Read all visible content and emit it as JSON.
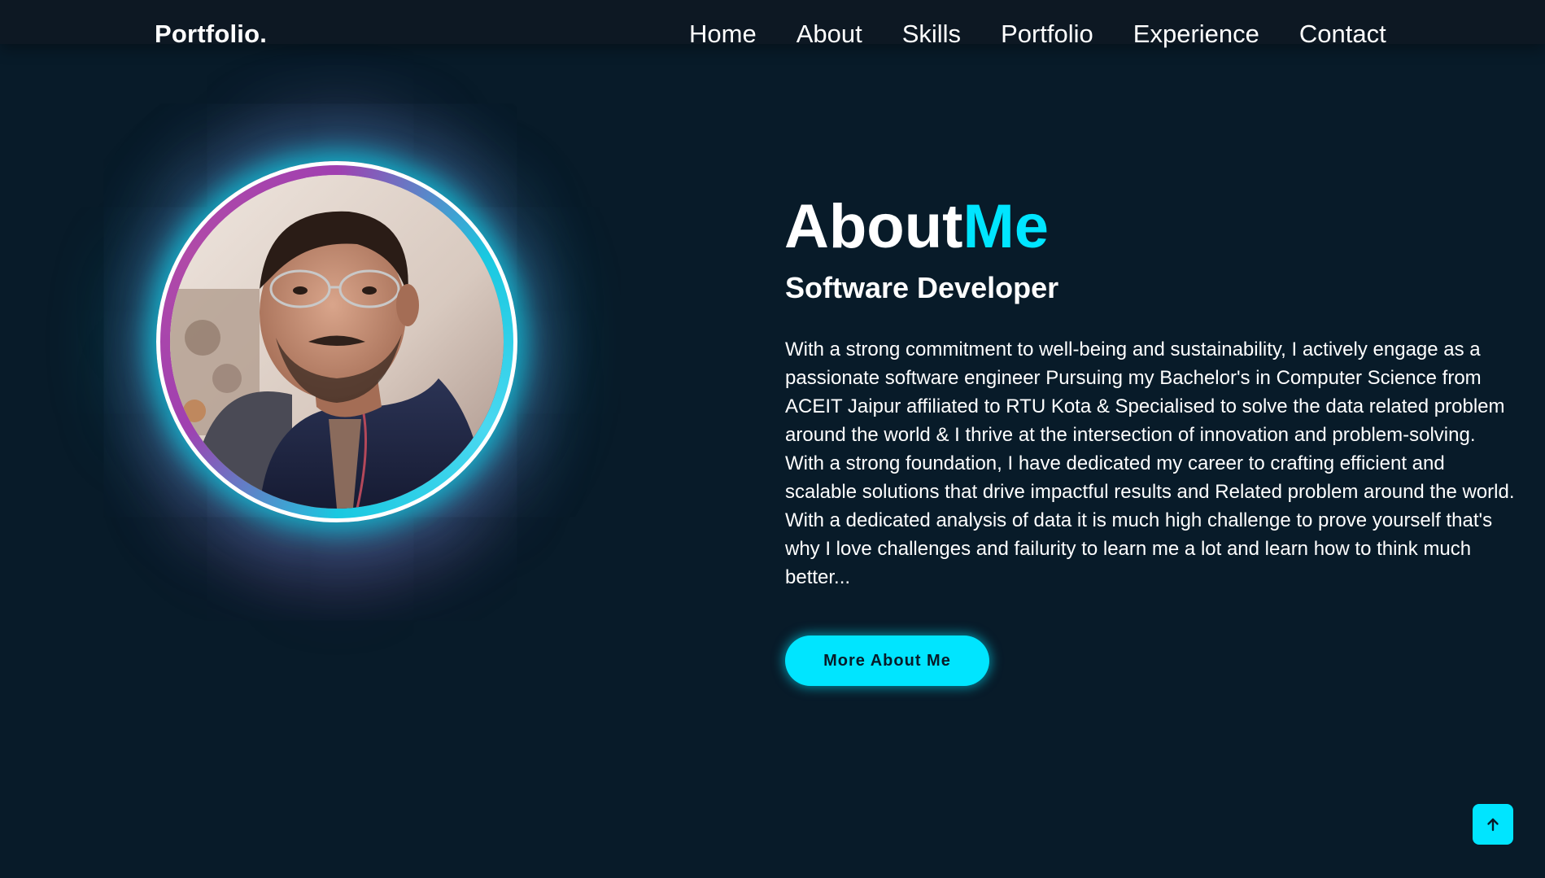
{
  "navbar": {
    "logo": "Portfolio.",
    "links": [
      {
        "label": "Home"
      },
      {
        "label": "About"
      },
      {
        "label": "Skills"
      },
      {
        "label": "Portfolio"
      },
      {
        "label": "Experience"
      },
      {
        "label": "Contact"
      }
    ]
  },
  "about": {
    "title_main": "About",
    "title_accent": "Me",
    "subtitle": "Software Developer",
    "paragraph_lines": [
      "With a strong commitment to well-being and sustainability, I actively engage as a",
      "passionate software engineer Pursuing my Bachelor's in Computer Science from",
      "ACEIT Jaipur affiliated to RTU Kota & Specialised to solve the data related problem",
      "around the world & I thrive at the intersection of innovation and problem-solving.",
      "With a strong foundation, I have dedicated my career to crafting efficient and",
      "scalable solutions that drive impactful results and Related problem around the world.",
      "With a dedicated analysis of data it is much high challenge to prove yourself that's",
      "why I love challenges and failurity to learn me a lot and learn how to think much",
      "better..."
    ],
    "button_label": "More About Me"
  },
  "scroll_top": {
    "icon": "arrow-up-icon"
  },
  "colors": {
    "background": "#081b29",
    "navbar": "#0d1823",
    "accent": "#00e5ff",
    "text": "#ffffff"
  }
}
